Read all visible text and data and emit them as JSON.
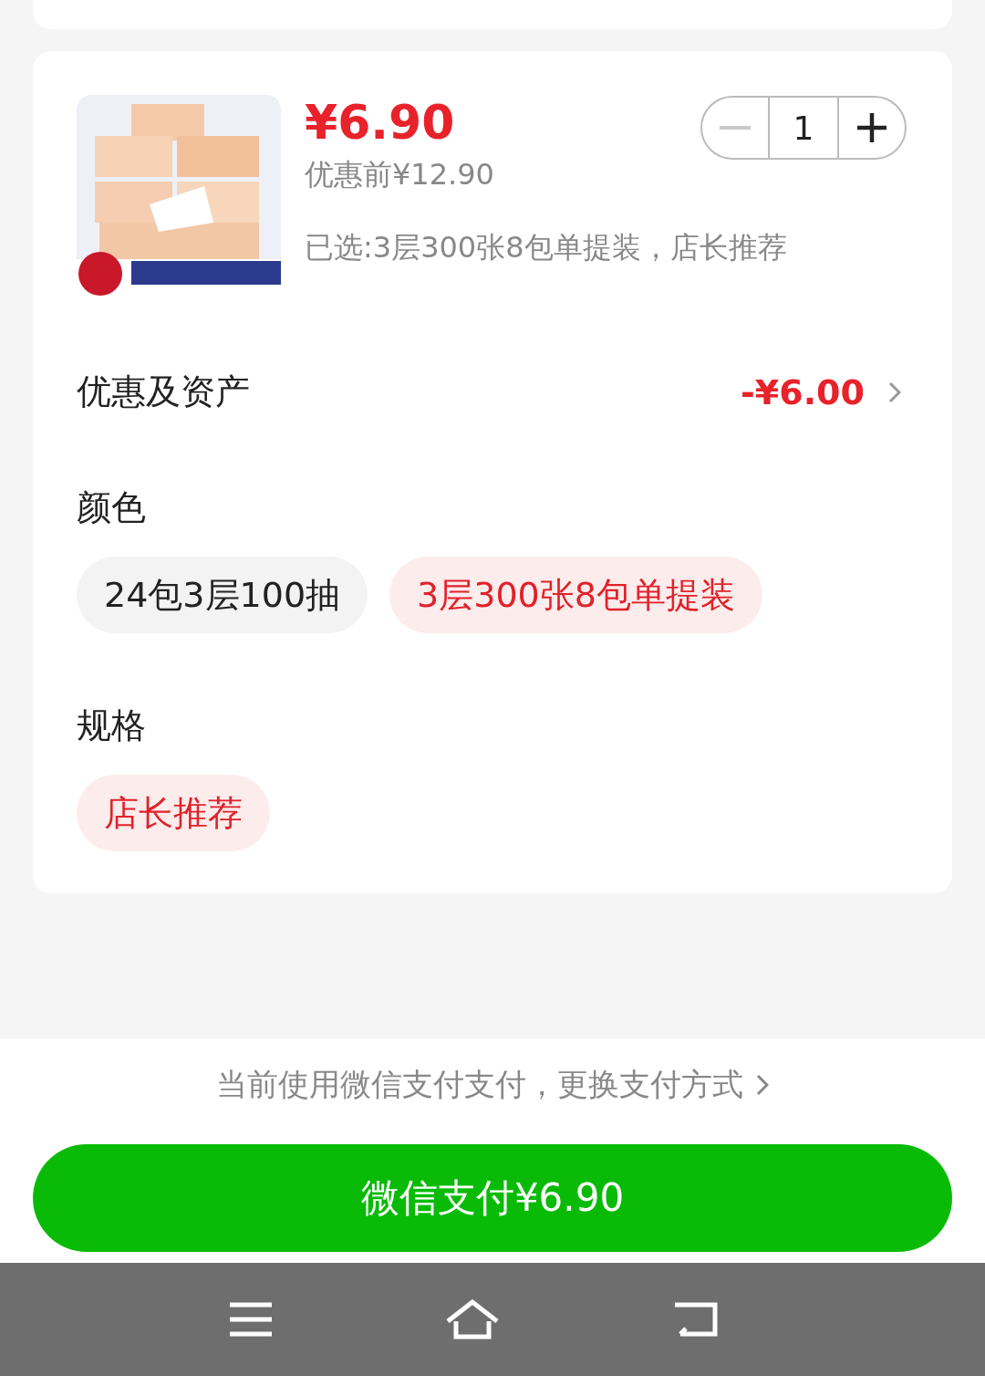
{
  "product": {
    "kind": "picture",
    "price": "¥6.90",
    "original_price": "优惠前¥12.90",
    "selection": "已选:3层300张8包单提装，店长推荐",
    "quantity": "1",
    "decrease_disabled": true
  },
  "discount": {
    "label": "优惠及资产",
    "value": "-¥6.00"
  },
  "options": [
    {
      "title": "颜色",
      "choices": [
        {
          "label": "24包3层100抽",
          "selected": false
        },
        {
          "label": "3层300张8包单提装",
          "selected": true
        }
      ]
    },
    {
      "title": "规格",
      "choices": [
        {
          "label": "店长推荐",
          "selected": true
        }
      ]
    }
  ],
  "payment_note": "当前使用微信支付支付，更换支付方式",
  "pay_button": "微信支付¥6.90"
}
